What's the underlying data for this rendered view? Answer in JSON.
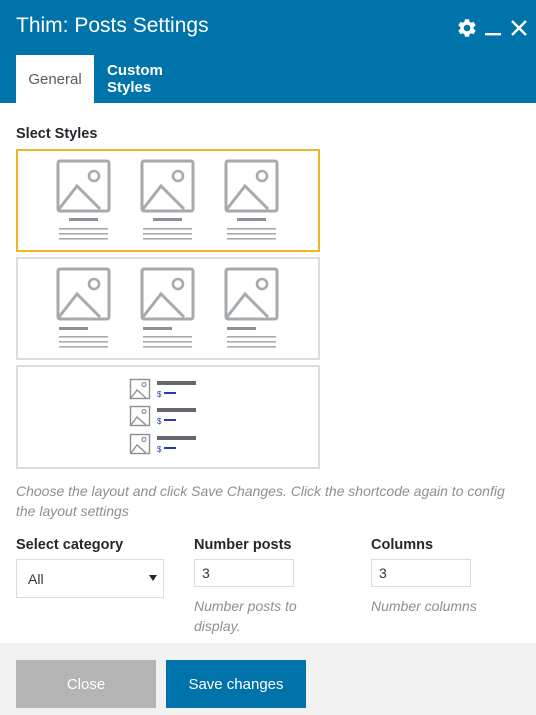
{
  "window": {
    "title": "Thim: Posts Settings"
  },
  "header_icons": [
    "gear-icon",
    "minimize-icon",
    "close-icon"
  ],
  "tabs": [
    {
      "label": "General",
      "active": true
    },
    {
      "label": "Custom Styles",
      "active": false
    }
  ],
  "styles": {
    "label": "Slect Styles",
    "options": [
      {
        "name": "grid-style-1",
        "selected": true
      },
      {
        "name": "grid-style-2",
        "selected": false
      },
      {
        "name": "list-style",
        "selected": false
      }
    ],
    "help": "Choose the layout and click Save Changes. Click the shortcode again to config the layout settings"
  },
  "fields": {
    "category": {
      "label": "Select category",
      "value": "All"
    },
    "number_posts": {
      "label": "Number posts",
      "value": "3",
      "help": "Number posts to display."
    },
    "columns": {
      "label": "Columns",
      "value": "3",
      "help": "Number columns"
    }
  },
  "buttons": {
    "close": "Close",
    "save": "Save changes"
  },
  "colors": {
    "header_bg": "#0073aa",
    "selected_border": "#f0b429",
    "accent_blue": "#1e40af",
    "close_button": "#b4b4b4"
  }
}
